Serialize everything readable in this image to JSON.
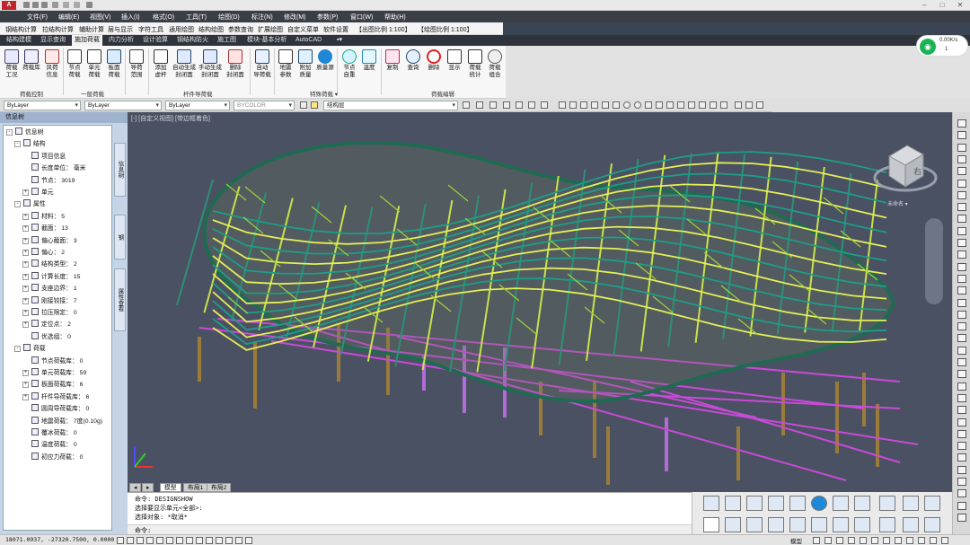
{
  "titlebar": {
    "app_icon": "A"
  },
  "menu": [
    "文件(F)",
    "编辑(E)",
    "视图(V)",
    "插入(I)",
    "格式(O)",
    "工具(T)",
    "绘图(D)",
    "标注(N)",
    "修改(M)",
    "参数(P)",
    "窗口(W)",
    "帮助(H)"
  ],
  "commandbar": [
    "钢结构计算",
    "拉结构计算",
    "辅助计算",
    "层与显示",
    "字符工具",
    "通用绘图",
    "结构绘图",
    "参数查询",
    "扩展绘图",
    "自定义菜单",
    "软件设置",
    "【出图比例 1:100】",
    "【绘图比例 1:100】"
  ],
  "tabs": [
    "结构建模",
    "显示查询",
    "施加荷载",
    "内力分析",
    "设计验算",
    "钢结构防火",
    "施工图",
    "模块-基本分析",
    "AutoCAD"
  ],
  "active_tab": "施加荷载",
  "ribbon": {
    "buttons": [
      {
        "label": "荷载\n工况",
        "icon": "load-case-icon"
      },
      {
        "label": "荷载库",
        "icon": "load-library-icon"
      },
      {
        "label": "风荷\n信息",
        "icon": "wind-load-icon"
      },
      {
        "label": "节点\n荷载",
        "icon": "node-load-icon"
      },
      {
        "label": "单元\n荷载",
        "icon": "element-load-icon"
      },
      {
        "label": "板面\n荷载",
        "icon": "slab-load-icon"
      },
      {
        "label": "导荷\n范围",
        "icon": "load-range-icon"
      },
      {
        "label": "添加\n虚杆",
        "icon": "add-virtual-bar-icon"
      },
      {
        "label": "自动生成\n封闭面",
        "icon": "auto-closed-face-icon"
      },
      {
        "label": "手动生成\n封闭面",
        "icon": "manual-closed-face-icon"
      },
      {
        "label": "删除\n封闭面",
        "icon": "delete-closed-face-icon"
      },
      {
        "label": "自动\n导荷载",
        "icon": "auto-load-icon"
      },
      {
        "label": "地震\n参数",
        "icon": "seismic-params-icon"
      },
      {
        "label": "附加\n质量",
        "icon": "additional-mass-icon"
      },
      {
        "label": "质量源",
        "icon": "mass-source-icon"
      },
      {
        "label": "节点\n自重",
        "icon": "node-self-weight-icon"
      },
      {
        "label": "温度",
        "icon": "temperature-icon"
      },
      {
        "label": "复制",
        "icon": "copy-icon"
      },
      {
        "label": "查询",
        "icon": "query-icon"
      },
      {
        "label": "删除",
        "icon": "delete-icon"
      },
      {
        "label": "显示",
        "icon": "display-icon"
      },
      {
        "label": "荷载\n统计",
        "icon": "load-stats-icon"
      },
      {
        "label": "荷载\n组合",
        "icon": "load-combo-icon"
      }
    ],
    "groups": [
      "荷载控制",
      "一般荷载",
      "杆件导荷载",
      "特殊荷载 ▾",
      "荷载编辑"
    ]
  },
  "network": {
    "speed": "0.00K/s",
    "count": "1",
    "icon": "wifi-icon"
  },
  "properties": {
    "layer": "ByLayer",
    "linetype": "ByLayer",
    "lineweight": "ByLayer",
    "color": "BYCOLOR",
    "layer_name": "结构层"
  },
  "left_panel": {
    "title": "信息树",
    "tree": [
      {
        "text": "信息树",
        "lvl": 0,
        "exp": "-",
        "icon": "tree-root-icon"
      },
      {
        "text": "结构",
        "lvl": 1,
        "exp": "-",
        "icon": "structure-icon"
      },
      {
        "text": "项目信息",
        "lvl": 2,
        "exp": "",
        "icon": "project-info-icon"
      },
      {
        "text": "长度单位： 毫米",
        "lvl": 2,
        "exp": "",
        "icon": "unit-icon"
      },
      {
        "text": "节点：  3019",
        "lvl": 2,
        "exp": "",
        "icon": "node-icon"
      },
      {
        "text": "单元",
        "lvl": 2,
        "exp": "+",
        "icon": "element-icon"
      },
      {
        "text": "属性",
        "lvl": 1,
        "exp": "-",
        "icon": "attributes-icon"
      },
      {
        "text": "材料：  5",
        "lvl": 2,
        "exp": "+",
        "icon": "material-icon"
      },
      {
        "text": "截面：  13",
        "lvl": 2,
        "exp": "+",
        "icon": "section-icon"
      },
      {
        "text": "偏心截面：  3",
        "lvl": 2,
        "exp": "+",
        "icon": "eccentric-section-icon"
      },
      {
        "text": "偏心：  2",
        "lvl": 2,
        "exp": "+",
        "icon": "eccentric-icon"
      },
      {
        "text": "结构类型：  2",
        "lvl": 2,
        "exp": "+",
        "icon": "structure-type-icon"
      },
      {
        "text": "计算长度：  15",
        "lvl": 2,
        "exp": "+",
        "icon": "calc-length-icon"
      },
      {
        "text": "支座边界：  1",
        "lvl": 2,
        "exp": "+",
        "icon": "support-icon"
      },
      {
        "text": "刚接铰接：  7",
        "lvl": 2,
        "exp": "+",
        "icon": "joint-icon"
      },
      {
        "text": "拉压限定：  0",
        "lvl": 2,
        "exp": "+",
        "icon": "tension-limit-icon"
      },
      {
        "text": "定位点：  2",
        "lvl": 2,
        "exp": "+",
        "icon": "anchor-icon"
      },
      {
        "text": "优选组：  0",
        "lvl": 2,
        "exp": "",
        "icon": "group-icon"
      },
      {
        "text": "荷载",
        "lvl": 1,
        "exp": "-",
        "icon": "load-icon"
      },
      {
        "text": "节点荷载库：  0",
        "lvl": 2,
        "exp": "",
        "icon": "node-load-lib-icon"
      },
      {
        "text": "单元荷载库：  59",
        "lvl": 2,
        "exp": "+",
        "icon": "element-load-lib-icon"
      },
      {
        "text": "板面荷载库：  6",
        "lvl": 2,
        "exp": "+",
        "icon": "slab-load-lib-icon"
      },
      {
        "text": "杆件导荷载库：  6",
        "lvl": 2,
        "exp": "+",
        "icon": "bar-load-lib-icon"
      },
      {
        "text": "圆周导荷载库：  0",
        "lvl": 2,
        "exp": "",
        "icon": "circular-load-lib-icon"
      },
      {
        "text": "地震荷载：  7度(0.10g)",
        "lvl": 2,
        "exp": "",
        "icon": "seismic-icon"
      },
      {
        "text": "覆冰荷载：  0",
        "lvl": 2,
        "exp": "",
        "icon": "ice-load-icon"
      },
      {
        "text": "温度荷载：  0",
        "lvl": 2,
        "exp": "",
        "icon": "temp-load-icon"
      },
      {
        "text": "初应力荷载：  0",
        "lvl": 2,
        "exp": "",
        "icon": "prestress-icon"
      }
    ],
    "side_tabs": [
      "信息树",
      "钢",
      "属性查看"
    ]
  },
  "viewport": {
    "label": "[-] [自定义视图] [带边框着色]",
    "cube_face": "右",
    "cube_label": "未命名 ▾"
  },
  "layout_tabs": [
    "模型",
    "布局1",
    "布局2"
  ],
  "command": {
    "lines": [
      "命令: DESIGNSHOW",
      "选择要显示单元<全部>:",
      "选择对象: *取消*"
    ],
    "prompt": "命令:"
  },
  "status": {
    "coords": "18071.0937,  -27320.7500,  0.0000",
    "model": "模型"
  }
}
